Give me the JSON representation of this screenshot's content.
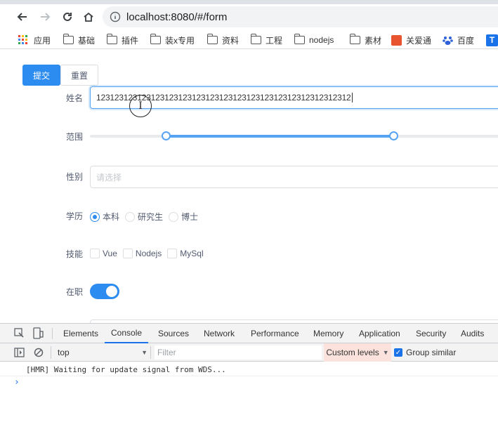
{
  "browser": {
    "url": "localhost:8080/#/form",
    "bookmarks": [
      {
        "label": "应用",
        "icon": "apps-grid-icon"
      },
      {
        "label": "基础",
        "icon": "folder-icon"
      },
      {
        "label": "插件",
        "icon": "folder-icon"
      },
      {
        "label": "装x专用",
        "icon": "folder-icon"
      },
      {
        "label": "资料",
        "icon": "folder-icon"
      },
      {
        "label": "工程",
        "icon": "folder-icon"
      },
      {
        "label": "nodejs",
        "icon": "folder-icon"
      },
      {
        "label": "素材",
        "icon": "folder-icon"
      },
      {
        "label": "关爱通",
        "icon": "guanaitong-logo-icon"
      },
      {
        "label": "百度",
        "icon": "baidu-paw-icon"
      },
      {
        "label": "T",
        "icon": "t-badge-icon"
      }
    ]
  },
  "form": {
    "submit_label": "提交",
    "reset_label": "重置",
    "name_label": "姓名",
    "name_value": "12312312312312312312312312312312312312312312312312312312",
    "range_label": "范围",
    "range": {
      "min": 0,
      "max": 100,
      "low": 18,
      "high": 72
    },
    "gender_label": "性别",
    "gender_placeholder": "请选择",
    "edu_label": "学历",
    "edu_options": [
      {
        "label": "本科",
        "checked": true
      },
      {
        "label": "研究生",
        "checked": false
      },
      {
        "label": "博士",
        "checked": false
      }
    ],
    "skills_label": "技能",
    "skills_options": [
      {
        "label": "Vue",
        "checked": false
      },
      {
        "label": "Nodejs",
        "checked": false
      },
      {
        "label": "MySql",
        "checked": false
      }
    ],
    "employed_label": "在职",
    "employed": true
  },
  "devtools": {
    "tabs": [
      "Elements",
      "Console",
      "Sources",
      "Network",
      "Performance",
      "Memory",
      "Application",
      "Security",
      "Audits"
    ],
    "active_tab": "Console",
    "context": "top",
    "filter_placeholder": "Filter",
    "levels_label": "Custom levels",
    "group_similar_label": "Group similar",
    "group_similar": true,
    "log_message": "[HMR] Waiting for update signal from WDS...",
    "prompt": "›"
  },
  "colors": {
    "primary": "#2d8cf0",
    "levels_bg": "#fbe2dd"
  }
}
